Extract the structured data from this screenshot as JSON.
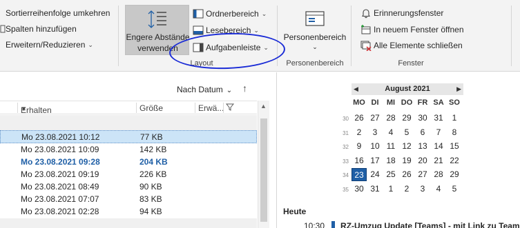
{
  "ribbon": {
    "left_group": {
      "sort_order": "Sortierreihenfolge umkehren",
      "add_columns": "Spalten hinzufügen",
      "expand_collapse": "Erweitern/Reduzieren"
    },
    "layout_group": {
      "big_button_line1": "Engere Abstände",
      "big_button_line2": "verwenden",
      "folder_pane": "Ordnerbereich",
      "reading_pane": "Lesebereich",
      "todo_bar": "Aufgabenleiste",
      "label": "Layout"
    },
    "people_group": {
      "people_pane": "Personenbereich",
      "label": "Personenbereich"
    },
    "window_group": {
      "reminders": "Erinnerungsfenster",
      "open_new_window": "In neuem Fenster öffnen",
      "close_all": "Alle Elemente schließen",
      "label": "Fenster"
    }
  },
  "mail_list": {
    "sort_label": "Nach Datum",
    "columns": {
      "received": "Erhalten",
      "size": "Größe",
      "mentioned": "Erwä..."
    },
    "rows": [
      {
        "date": "Mo 23.08.2021 10:12",
        "size": "77 KB",
        "state": "selected"
      },
      {
        "date": "Mo 23.08.2021 10:09",
        "size": "142 KB",
        "state": "normal"
      },
      {
        "date": "Mo 23.08.2021 09:28",
        "size": "204 KB",
        "state": "unread"
      },
      {
        "date": "Mo 23.08.2021 09:19",
        "size": "226 KB",
        "state": "normal"
      },
      {
        "date": "Mo 23.08.2021 08:49",
        "size": "90 KB",
        "state": "normal"
      },
      {
        "date": "Mo 23.08.2021 07:07",
        "size": "83 KB",
        "state": "normal"
      },
      {
        "date": "Mo 23.08.2021 02:28",
        "size": "94 KB",
        "state": "normal"
      }
    ]
  },
  "calendar": {
    "month": "August 2021",
    "weekdays": [
      "MO",
      "DI",
      "MI",
      "DO",
      "FR",
      "SA",
      "SO"
    ],
    "week_numbers": [
      "30",
      "31",
      "32",
      "33",
      "34",
      "35"
    ],
    "weeks": [
      [
        "26",
        "27",
        "28",
        "29",
        "30",
        "31",
        "1"
      ],
      [
        "2",
        "3",
        "4",
        "5",
        "6",
        "7",
        "8"
      ],
      [
        "9",
        "10",
        "11",
        "12",
        "13",
        "14",
        "15"
      ],
      [
        "16",
        "17",
        "18",
        "19",
        "20",
        "21",
        "22"
      ],
      [
        "23",
        "24",
        "25",
        "26",
        "27",
        "28",
        "29"
      ],
      [
        "30",
        "31",
        "1",
        "2",
        "3",
        "4",
        "5"
      ]
    ],
    "today": "23",
    "today_label": "Heute",
    "appointment": {
      "time": "10:30",
      "title": "RZ-Umzug Update [Teams] - mit Link zu Teams"
    }
  },
  "colors": {
    "accent": "#1f5fa6",
    "selection": "#cce4f7",
    "annotation": "#1a2bd6"
  }
}
